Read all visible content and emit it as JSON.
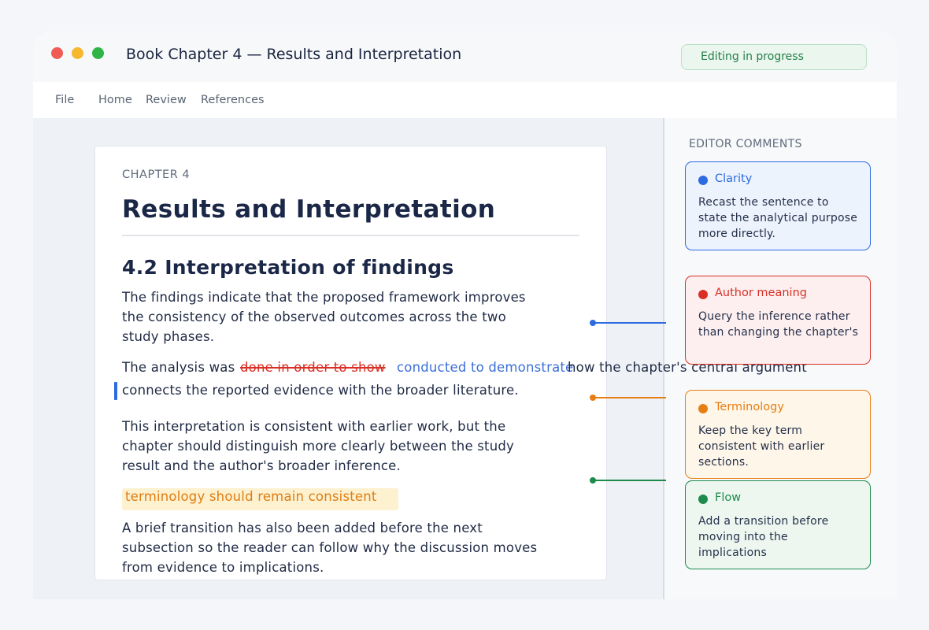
{
  "window": {
    "title": "Book Chapter 4 — Results and Interpretation",
    "status": "Editing in progress"
  },
  "menu": [
    "File",
    "Home",
    "Review",
    "References"
  ],
  "document": {
    "chapter_label": "CHAPTER 4",
    "chapter_title": "Results and Interpretation",
    "section_heading": "4.2 Interpretation of findings",
    "para1": [
      "The findings indicate that the proposed framework improves",
      "the consistency of the observed outcomes across the two",
      "study phases."
    ],
    "para2": {
      "prefix": "The analysis was ",
      "deleted": "done in order to show",
      "inserted": "conducted to demonstrate",
      "suffix": "how the chapter's central argument",
      "line2": "connects the reported evidence with the broader literature."
    },
    "para3": [
      "This interpretation is consistent with earlier work, but the",
      "chapter should distinguish more clearly between the study",
      "result and the author's broader inference."
    ],
    "highlight": "terminology should remain consistent",
    "para4": [
      "A brief transition has also been added before the next",
      "subsection so the reader can follow why the discussion moves",
      "from evidence to implications."
    ]
  },
  "comments_panel": {
    "title": "EDITOR COMMENTS",
    "comments": [
      {
        "title": "Clarity",
        "body": "Recast the sentence to state the analytical purpose more directly.",
        "color": "#2d6be0",
        "bg": "#edf3fd",
        "border": "#2d6be0"
      },
      {
        "title": "Author meaning",
        "body": "Query the inference rather than changing the chapter's",
        "color": "#d93025",
        "bg": "#fdefef",
        "border": "#d93025"
      },
      {
        "title": "Terminology",
        "body": "Keep the key term consistent with earlier sections.",
        "color": "#e67e14",
        "bg": "#fef6e9",
        "border": "#e67e14"
      },
      {
        "title": "Flow",
        "body": "Add a transition before moving into the implications",
        "color": "#1e8a4c",
        "bg": "#edf7f0",
        "border": "#1e8a4c"
      }
    ]
  },
  "colors": {
    "deleted": "#d93025",
    "inserted": "#3b6fd8",
    "highlight_text": "#e07d12",
    "highlight_bg": "#fdf1cf",
    "change_bar": "#2d6be0"
  }
}
